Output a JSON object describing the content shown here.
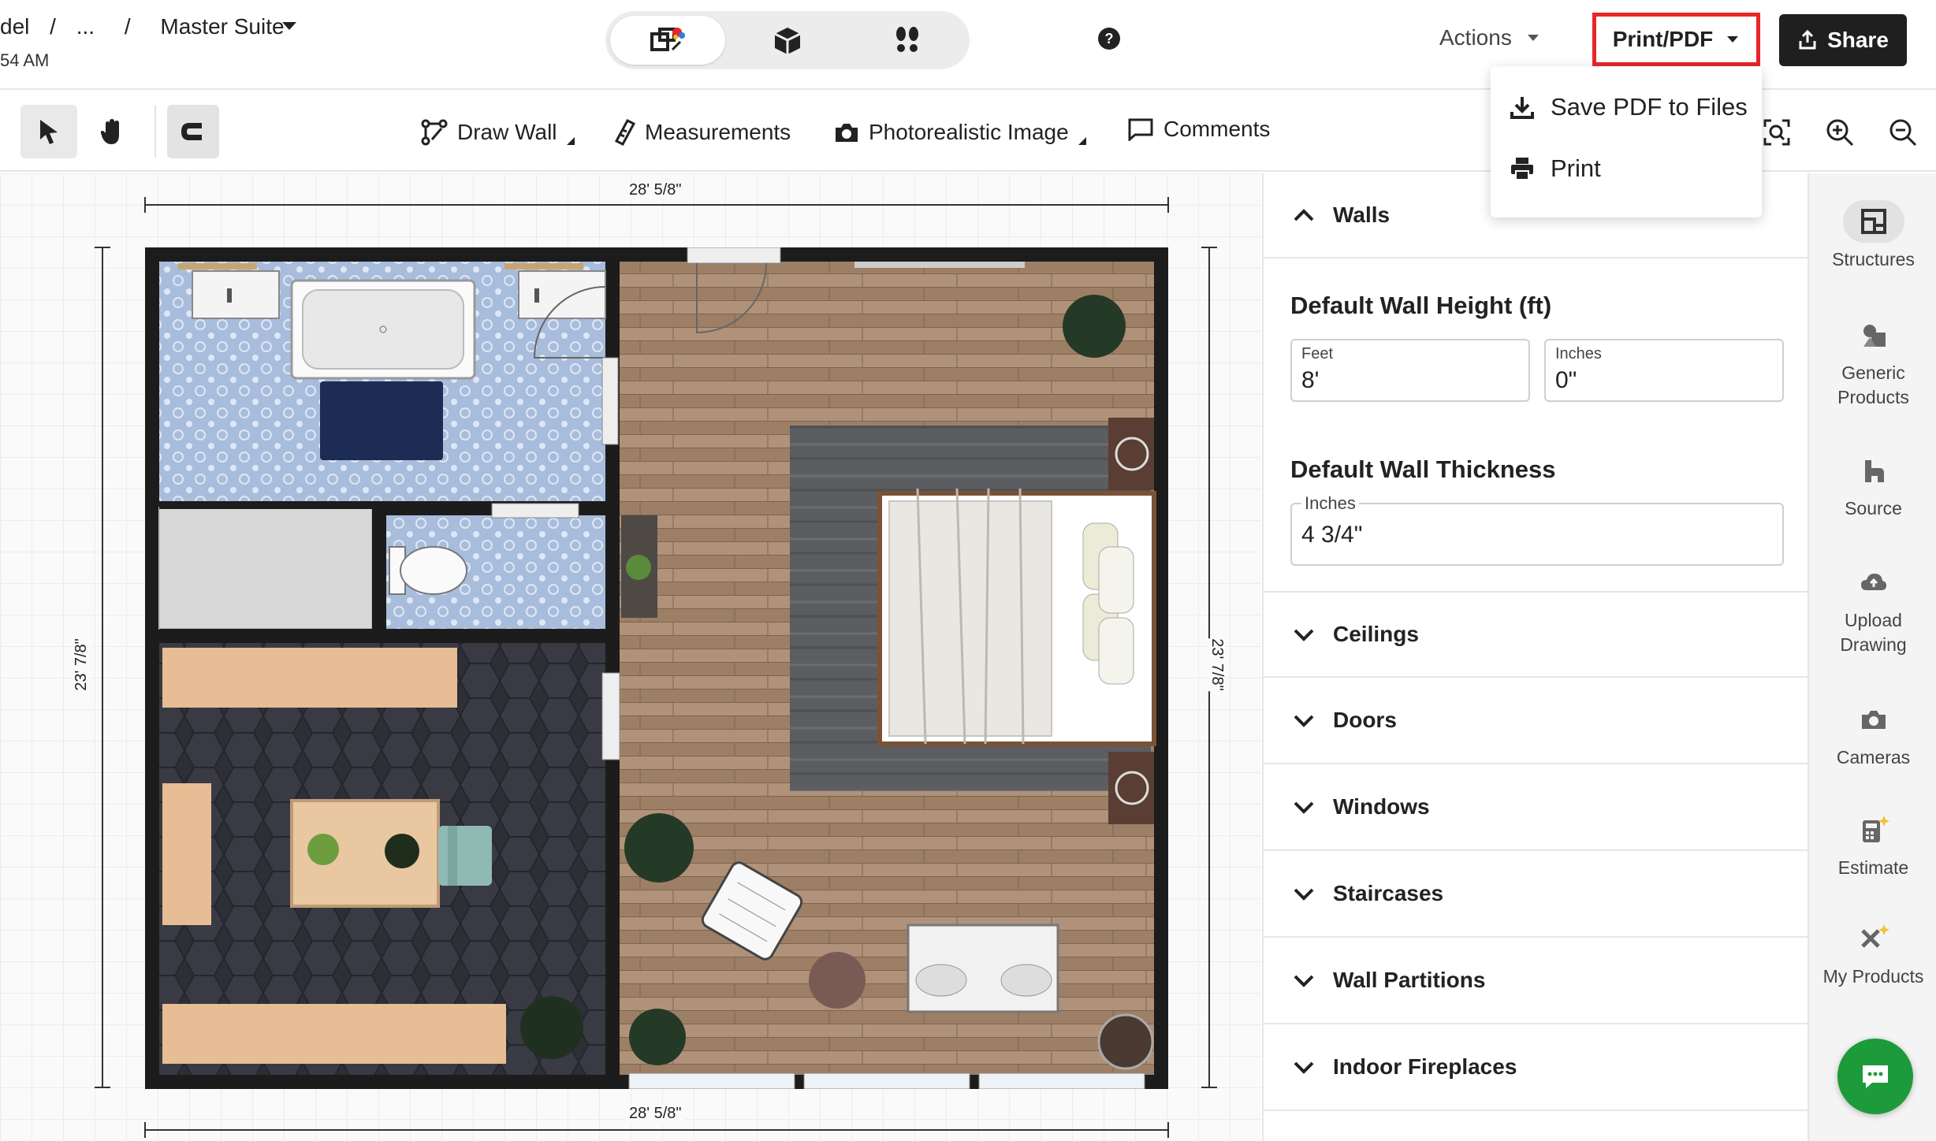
{
  "header": {
    "breadcrumb_prefix": "del",
    "sep1": "/",
    "ellipsis": "...",
    "sep2": "/",
    "project": "Master Suite",
    "time_fragment": "54 AM",
    "modes": [
      "2d-plan-icon",
      "3d-box-icon",
      "walkthrough-icon"
    ],
    "help_icon": "help-icon",
    "actions_label": "Actions",
    "print_label": "Print/PDF",
    "share_label": "Share"
  },
  "dropdown": {
    "items": [
      {
        "label": "Save PDF to Files",
        "icon": "download-icon"
      },
      {
        "label": "Print",
        "icon": "printer-icon"
      }
    ]
  },
  "toolbar": {
    "draw_wall": "Draw Wall",
    "measurements": "Measurements",
    "photo_image": "Photorealistic Image",
    "comments": "Comments"
  },
  "canvas": {
    "dim_top": "28' 5/8\"",
    "dim_bottom": "28' 5/8\"",
    "dim_left": "23' 7/8\"",
    "dim_right": "23' 7/8\""
  },
  "panel": {
    "walls_label": "Walls",
    "wall_height_title": "Default Wall Height (ft)",
    "feet_caption": "Feet",
    "feet_value": "8'",
    "inches_caption": "Inches",
    "inches_value": "0\"",
    "wall_thickness_title": "Default Wall Thickness",
    "thickness_caption": "Inches",
    "thickness_value": "4 3/4\"",
    "sections": [
      "Ceilings",
      "Doors",
      "Windows",
      "Staircases",
      "Wall Partitions",
      "Indoor Fireplaces"
    ]
  },
  "rail": {
    "items": [
      {
        "label": "Structures",
        "icon": "structures-icon"
      },
      {
        "label": "Generic Products",
        "icon": "generic-products-icon"
      },
      {
        "label": "Source",
        "icon": "source-icon"
      },
      {
        "label": "Upload Drawing",
        "icon": "upload-icon"
      },
      {
        "label": "Cameras",
        "icon": "camera-icon"
      },
      {
        "label": "Estimate",
        "icon": "calculator-icon"
      },
      {
        "label": "My Products",
        "icon": "my-products-icon"
      }
    ]
  },
  "colors": {
    "accent_red": "#e8262b",
    "share_bg": "#1f1f1f",
    "chat_green": "#1d9b3a",
    "floor_wood": "#a88a6e",
    "tile_blue": "#9fb3d6",
    "wall_dark": "#1c1c1c"
  }
}
